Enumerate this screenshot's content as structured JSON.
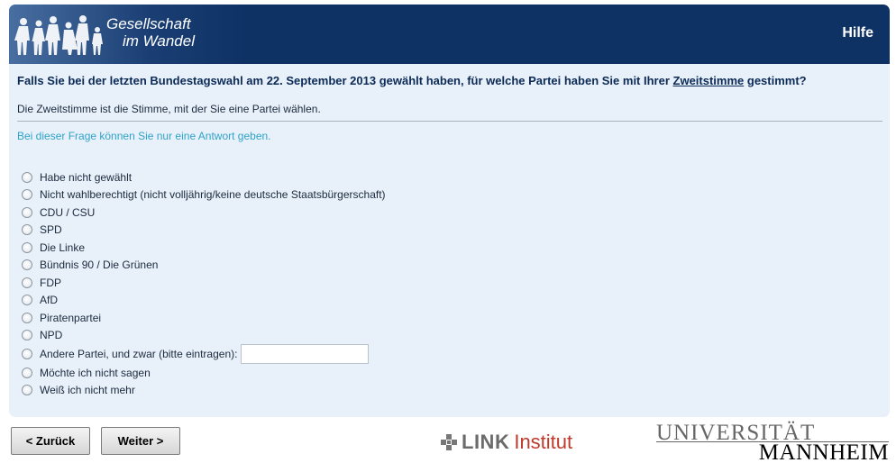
{
  "header": {
    "logo_line1": "Gesellschaft",
    "logo_line2": "im Wandel",
    "help_label": "Hilfe"
  },
  "question": {
    "text_before": "Falls Sie bei der letzten Bundestagswahl am 22. September 2013 gewählt haben, für welche Partei haben Sie mit Ihrer ",
    "text_underlined": "Zweitstimme",
    "text_after": " gestimmt?",
    "explanation": "Die Zweitstimme ist die Stimme, mit der Sie eine Partei wählen.",
    "hint": "Bei dieser Frage können Sie nur eine Antwort geben."
  },
  "options": [
    "Habe nicht gewählt",
    "Nicht wahlberechtigt (nicht volljährig/keine deutsche Staatsbürgerschaft)",
    "CDU / CSU",
    "SPD",
    "Die Linke",
    "Bündnis 90 / Die Grünen",
    "FDP",
    "AfD",
    "Piratenpartei",
    "NPD",
    "Andere Partei, und zwar (bitte eintragen):",
    "Möchte ich nicht sagen",
    "Weiß ich nicht mehr"
  ],
  "other_party_input": {
    "value": "",
    "placeholder": ""
  },
  "navigation": {
    "back_label": "< Zurück",
    "next_label": "Weiter >"
  },
  "footer": {
    "link_word": "LINK",
    "link_institut": "Institut",
    "uni_line1": "UNIVERSITÄT",
    "uni_line2": "MANNHEIM"
  },
  "colors": {
    "header_bg": "#0f3265",
    "panel_bg": "#e8f0fa",
    "question_text": "#0b2a55",
    "hint_text": "#2fa3c9",
    "link_red": "#c0392b"
  }
}
